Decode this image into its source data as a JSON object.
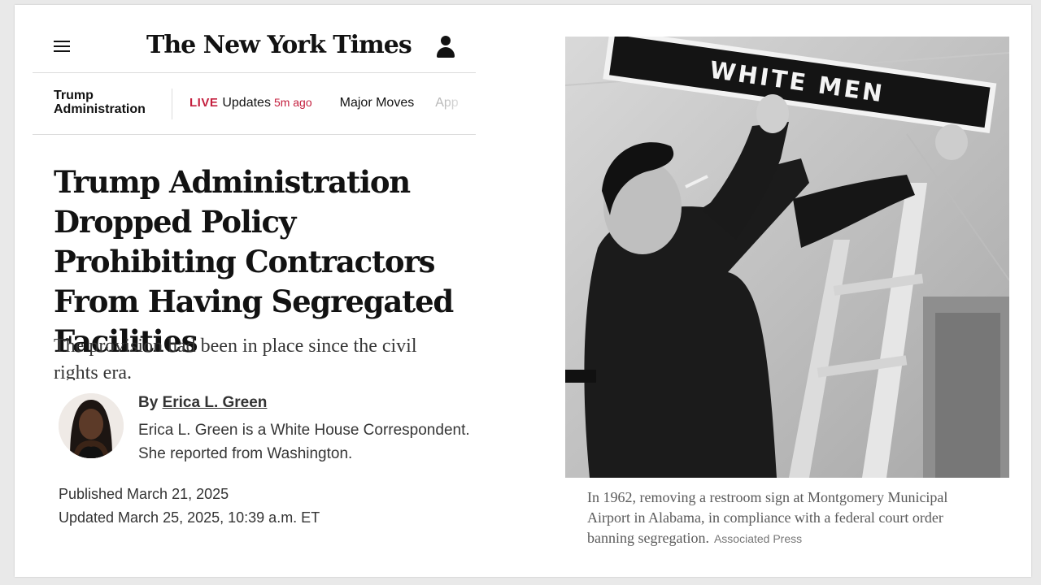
{
  "header": {
    "logo_text": "The New York Times",
    "menu_icon": "hamburger-menu-icon",
    "account_icon": "user-account-icon"
  },
  "nav": {
    "section": "Trump Administration",
    "live_label": "LIVE",
    "updates_label": "Updates",
    "updated_ago": "5m ago",
    "items": [
      "Major Moves",
      "App"
    ]
  },
  "article": {
    "headline": "Trump Administration Dropped Policy Prohibiting Contractors From Having Segregated Facilities",
    "summary": "The provision had been in place since the civil rights era.",
    "byline_prefix": "By",
    "author": "Erica L. Green",
    "author_bio_line1": "Erica L. Green is a White House Correspondent.",
    "author_bio_line2": "She reported from Washington.",
    "published": "Published March 21, 2025",
    "updated": "Updated March 25, 2025, 10:39 a.m. ET"
  },
  "photo": {
    "sign_text": "WHITE MEN",
    "caption": "In 1962, removing a restroom sign at Montgomery Municipal Airport in Alabama, in compliance with a federal court order banning segregation.",
    "credit": "Associated Press"
  },
  "colors": {
    "live_red": "#c41f3e",
    "text": "#121212",
    "rule": "#dcdcdc"
  }
}
